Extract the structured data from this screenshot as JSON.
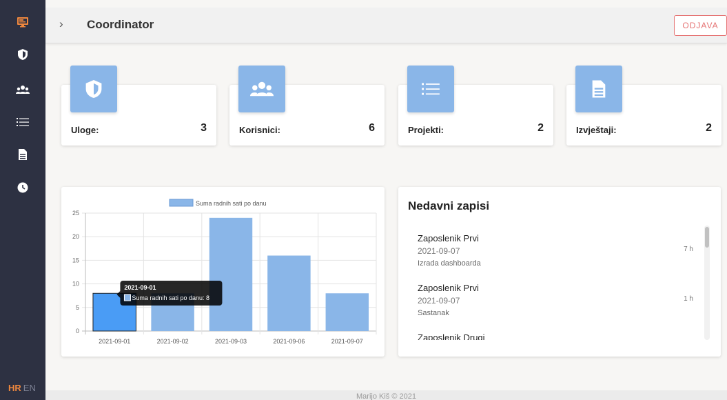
{
  "colors": {
    "sidebar_bg": "#2d3142",
    "accent_orange": "#f0883e",
    "tile_blue": "#8ab6e8",
    "logout_red": "#e57373",
    "bar_blue": "#8ab6e8",
    "bar_active": "#4a9cf5"
  },
  "sidebar": {
    "logo_icon": "monitor-icon",
    "items": [
      {
        "name": "roles",
        "icon": "shield-icon"
      },
      {
        "name": "users",
        "icon": "users-icon"
      },
      {
        "name": "projects",
        "icon": "list-icon"
      },
      {
        "name": "reports",
        "icon": "document-icon"
      },
      {
        "name": "time",
        "icon": "clock-icon"
      }
    ],
    "lang_active": "HR",
    "lang_other": "EN"
  },
  "header": {
    "title": "Coordinator",
    "chevron": "›",
    "logout_label": "ODJAVA"
  },
  "stats": [
    {
      "label": "Uloge:",
      "value": "3",
      "icon": "shield-icon"
    },
    {
      "label": "Korisnici:",
      "value": "6",
      "icon": "users-icon"
    },
    {
      "label": "Projekti:",
      "value": "2",
      "icon": "list-icon"
    },
    {
      "label": "Izvještaji:",
      "value": "2",
      "icon": "document-icon"
    }
  ],
  "chart_data": {
    "type": "bar",
    "categories": [
      "2021-09-01",
      "2021-09-02",
      "2021-09-03",
      "2021-09-06",
      "2021-09-07"
    ],
    "series": [
      {
        "name": "Suma radnih sati po danu",
        "values": [
          8,
          8,
          24,
          16,
          8
        ]
      }
    ],
    "ylim": [
      0,
      25
    ],
    "yticks": [
      0,
      5,
      10,
      15,
      20,
      25
    ],
    "grid": true,
    "legend_position": "top",
    "tooltip": {
      "title": "2021-09-01",
      "text": "Suma radnih sati po danu: 8",
      "index": 0
    }
  },
  "recent": {
    "title": "Nedavni zapisi",
    "entries": [
      {
        "name": "Zaposlenik Prvi",
        "date": "2021-09-07",
        "description": "Izrada dashboarda",
        "hours": "7 h"
      },
      {
        "name": "Zaposlenik Prvi",
        "date": "2021-09-07",
        "description": "Sastanak",
        "hours": "1 h"
      },
      {
        "name": "Zaposlenik Drugi",
        "date": "",
        "description": "",
        "hours": ""
      }
    ]
  },
  "footer": {
    "text": "Marijo Kiš © 2021"
  }
}
